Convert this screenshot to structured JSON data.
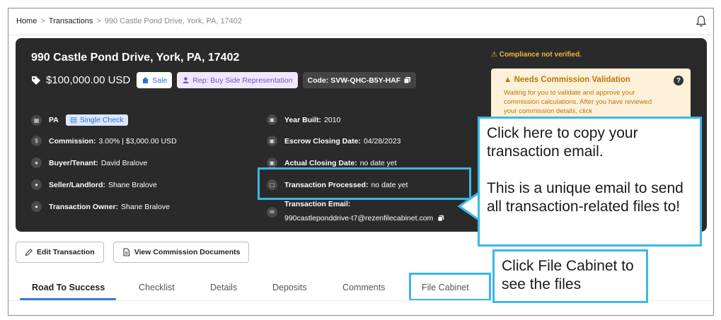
{
  "breadcrumb": {
    "home": "Home",
    "sep1": ">",
    "transactions": "Transactions",
    "sep2": ">",
    "current": "990 Castle Pond Drive, York, PA, 17402"
  },
  "icons": {
    "bell": "bell-icon",
    "tag": "tag-icon",
    "home": "home-icon",
    "user": "user-icon",
    "copy": "copy-icon",
    "calendar": "calendar-icon",
    "mail": "mail-icon",
    "help": "help-icon",
    "warning": "warning-icon",
    "pencil": "pencil-icon",
    "document": "document-icon"
  },
  "transaction": {
    "address": "990 Castle Pond Drive, York, PA, 17402",
    "price": "$100,000.00 USD",
    "type_label": "Sale",
    "rep_label": "Rep: Buy Side Representation",
    "code_label": "Code: SVW-QHC-B5Y-HAF"
  },
  "details_left": {
    "state": "PA",
    "single_check": "Single Check",
    "commission_label": "Commission:",
    "commission_value": "3.00% | $3,000.00 USD",
    "buyer_label": "Buyer/Tenant:",
    "buyer_value": "David Bralove",
    "seller_label": "Seller/Landlord:",
    "seller_value": "Shane Bralove",
    "owner_label": "Transaction Owner:",
    "owner_value": "Shane Bralove"
  },
  "details_right": {
    "year_label": "Year Built:",
    "year_value": "2010",
    "escrow_label": "Escrow Closing Date:",
    "escrow_value": "04/28/2023",
    "actual_label": "Actual Closing Date:",
    "actual_value": "no date yet",
    "processed_label": "Transaction Processed:",
    "processed_value": "no date yet",
    "email_label": "Transaction Email:",
    "email_value": "990castleponddrive-t7@rezenfilecabinet.com"
  },
  "compliance": {
    "status": "⚠ Compliance not verified.",
    "title": "Needs Commission Validation",
    "body": "Waiting for you to validate and approve your commission calculations. After you have reviewed your commission details, click"
  },
  "callouts": {
    "copy_email_line1": "Click here to copy your transaction email.",
    "copy_email_line2": "This is a unique email to send all transaction-related files to!",
    "file_cabinet": "Click File Cabinet to see the files"
  },
  "actions": {
    "edit": "Edit Transaction",
    "view_docs": "View Commission Documents"
  },
  "tabs": [
    {
      "label": "Road To Success"
    },
    {
      "label": "Checklist"
    },
    {
      "label": "Details"
    },
    {
      "label": "Deposits"
    },
    {
      "label": "Comments"
    },
    {
      "label": "File Cabinet"
    }
  ],
  "colors": {
    "accent": "#3bb8e3",
    "primary_blue": "#2f6fde",
    "card_bg": "#2a2a2a",
    "warning": "#f3b53b"
  }
}
